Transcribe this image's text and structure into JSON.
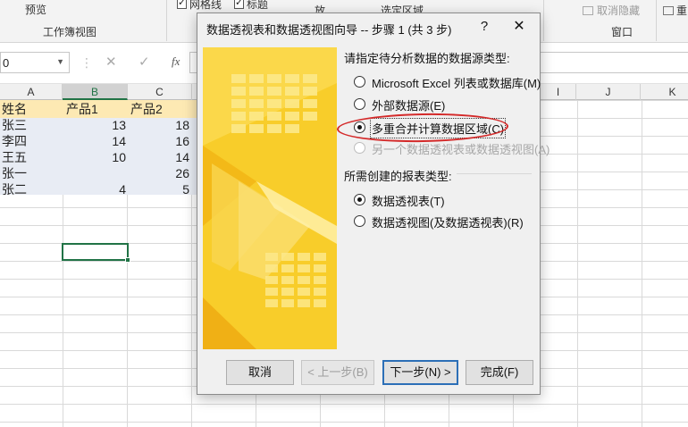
{
  "ribbon": {
    "preview_label": "预览",
    "workbook_view_group": "工作簿视图",
    "gridlines_label": "网格线",
    "headings_label": "标题",
    "zoom_fragment": "放",
    "zoom_selection_label": "选定区域",
    "unhide_label": "取消隐藏",
    "window_group": "窗口",
    "cut_fragment": "重"
  },
  "formula_bar": {
    "name_box_value": "0",
    "cancel_icon": "close-icon",
    "enter_icon": "check-icon",
    "fx_label": "fx",
    "formula_value": ""
  },
  "sheet": {
    "columns": [
      "A",
      "B",
      "C",
      "I",
      "J",
      "K"
    ],
    "rows": [
      [
        "姓名",
        "产品1",
        "产品2"
      ],
      [
        "张三",
        "13",
        "18"
      ],
      [
        "李四",
        "14",
        "16"
      ],
      [
        "王五",
        "10",
        "14"
      ],
      [
        "张一",
        "",
        "26"
      ],
      [
        "张二",
        "4",
        "5"
      ]
    ],
    "header_band_color": "#fde9b3",
    "data_band_color": "#e8ecf4"
  },
  "dialog": {
    "title": "数据透视表和数据透视图向导 -- 步骤 1 (共 3 步)",
    "help_label": "?",
    "close_label": "✕",
    "source_section_label": "请指定待分析数据的数据源类型:",
    "source_options": [
      {
        "label": "Microsoft Excel 列表或数据库(M)",
        "selected": false,
        "disabled": false
      },
      {
        "label": "外部数据源(E)",
        "selected": false,
        "disabled": false
      },
      {
        "label": "多重合并计算数据区域(C)",
        "selected": true,
        "disabled": false
      },
      {
        "label": "另一个数据透视表或数据透视图(A)",
        "selected": false,
        "disabled": true
      }
    ],
    "report_section_label": "所需创建的报表类型:",
    "report_options": [
      {
        "label": "数据透视表(T)",
        "selected": true
      },
      {
        "label": "数据透视图(及数据透视表)(R)",
        "selected": false
      }
    ],
    "buttons": {
      "cancel": "取消",
      "back": "< 上一步(B)",
      "next": "下一步(N) >",
      "finish": "完成(F)"
    },
    "highlight_color": "#d42a2a",
    "accent_yellow": "#f7c51e"
  }
}
